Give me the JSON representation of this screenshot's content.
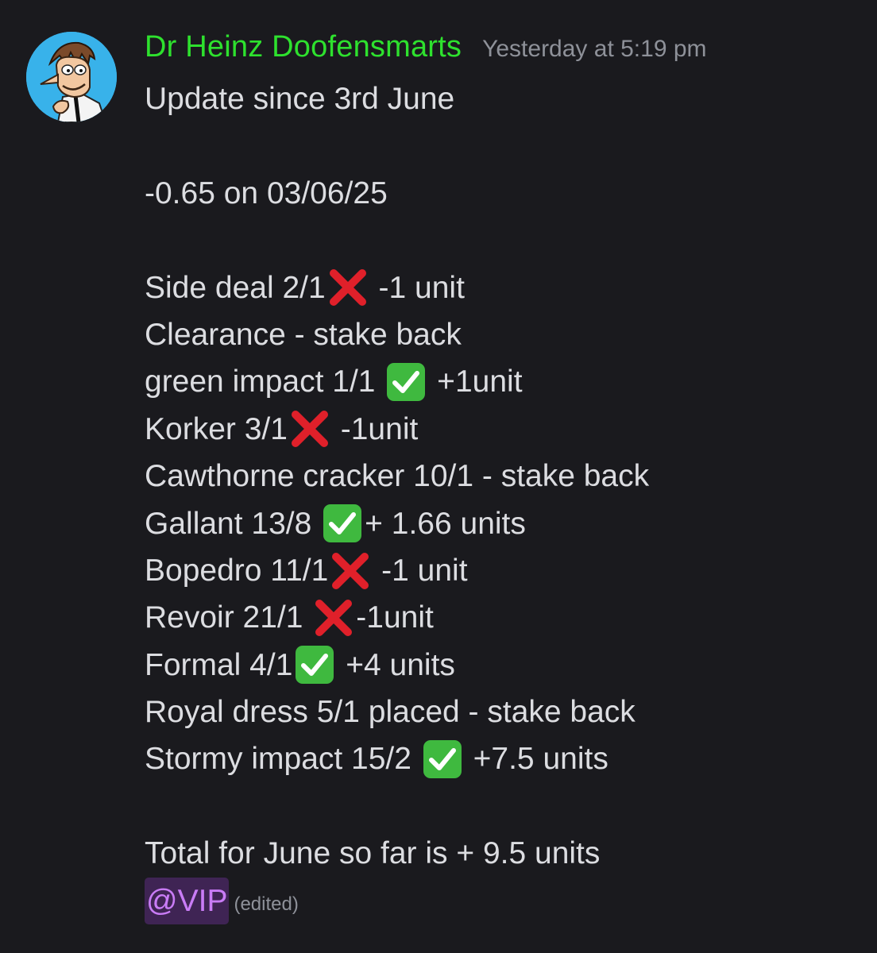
{
  "message": {
    "author": "Dr Heinz Doofensmarts",
    "timestamp": "Yesterday at 5:19 pm",
    "author_color": "#2ee12e",
    "avatar_icon": "doofenshmirtz-avatar",
    "lines": [
      {
        "before": "Update since 3rd June"
      },
      {
        "before": ""
      },
      {
        "before": "-0.65 on 03/06/25"
      },
      {
        "before": ""
      },
      {
        "before": "Side deal 2/1",
        "emoji": "cross-mark",
        "after": " -1 unit"
      },
      {
        "before": "Clearance - stake back"
      },
      {
        "before": "green impact 1/1 ",
        "emoji": "check-mark",
        "after": " +1unit"
      },
      {
        "before": "Korker 3/1",
        "emoji": "cross-mark",
        "after": " -1unit"
      },
      {
        "before": "Cawthorne cracker 10/1 - stake back"
      },
      {
        "before": "Gallant 13/8 ",
        "emoji": "check-mark",
        "after": "+ 1.66 units"
      },
      {
        "before": "Bopedro 11/1",
        "emoji": "cross-mark",
        "after": " -1 unit"
      },
      {
        "before": "Revoir 21/1 ",
        "emoji": "cross-mark",
        "after": "-1unit"
      },
      {
        "before": "Formal 4/1",
        "emoji": "check-mark",
        "after": " +4 units"
      },
      {
        "before": "Royal dress 5/1 placed - stake back"
      },
      {
        "before": "Stormy impact 15/2 ",
        "emoji": "check-mark",
        "after": " +7.5 units"
      },
      {
        "before": ""
      },
      {
        "before": "Total for June so far is + 9.5 units"
      }
    ],
    "mention": "@VIP",
    "edited_label": "(edited)"
  },
  "colors": {
    "background": "#1a1a1e",
    "text": "#dcdde1",
    "muted": "#8e9199",
    "mention_text": "#c97cf6",
    "check": "#3fb93f",
    "cross": "#e0202a"
  }
}
